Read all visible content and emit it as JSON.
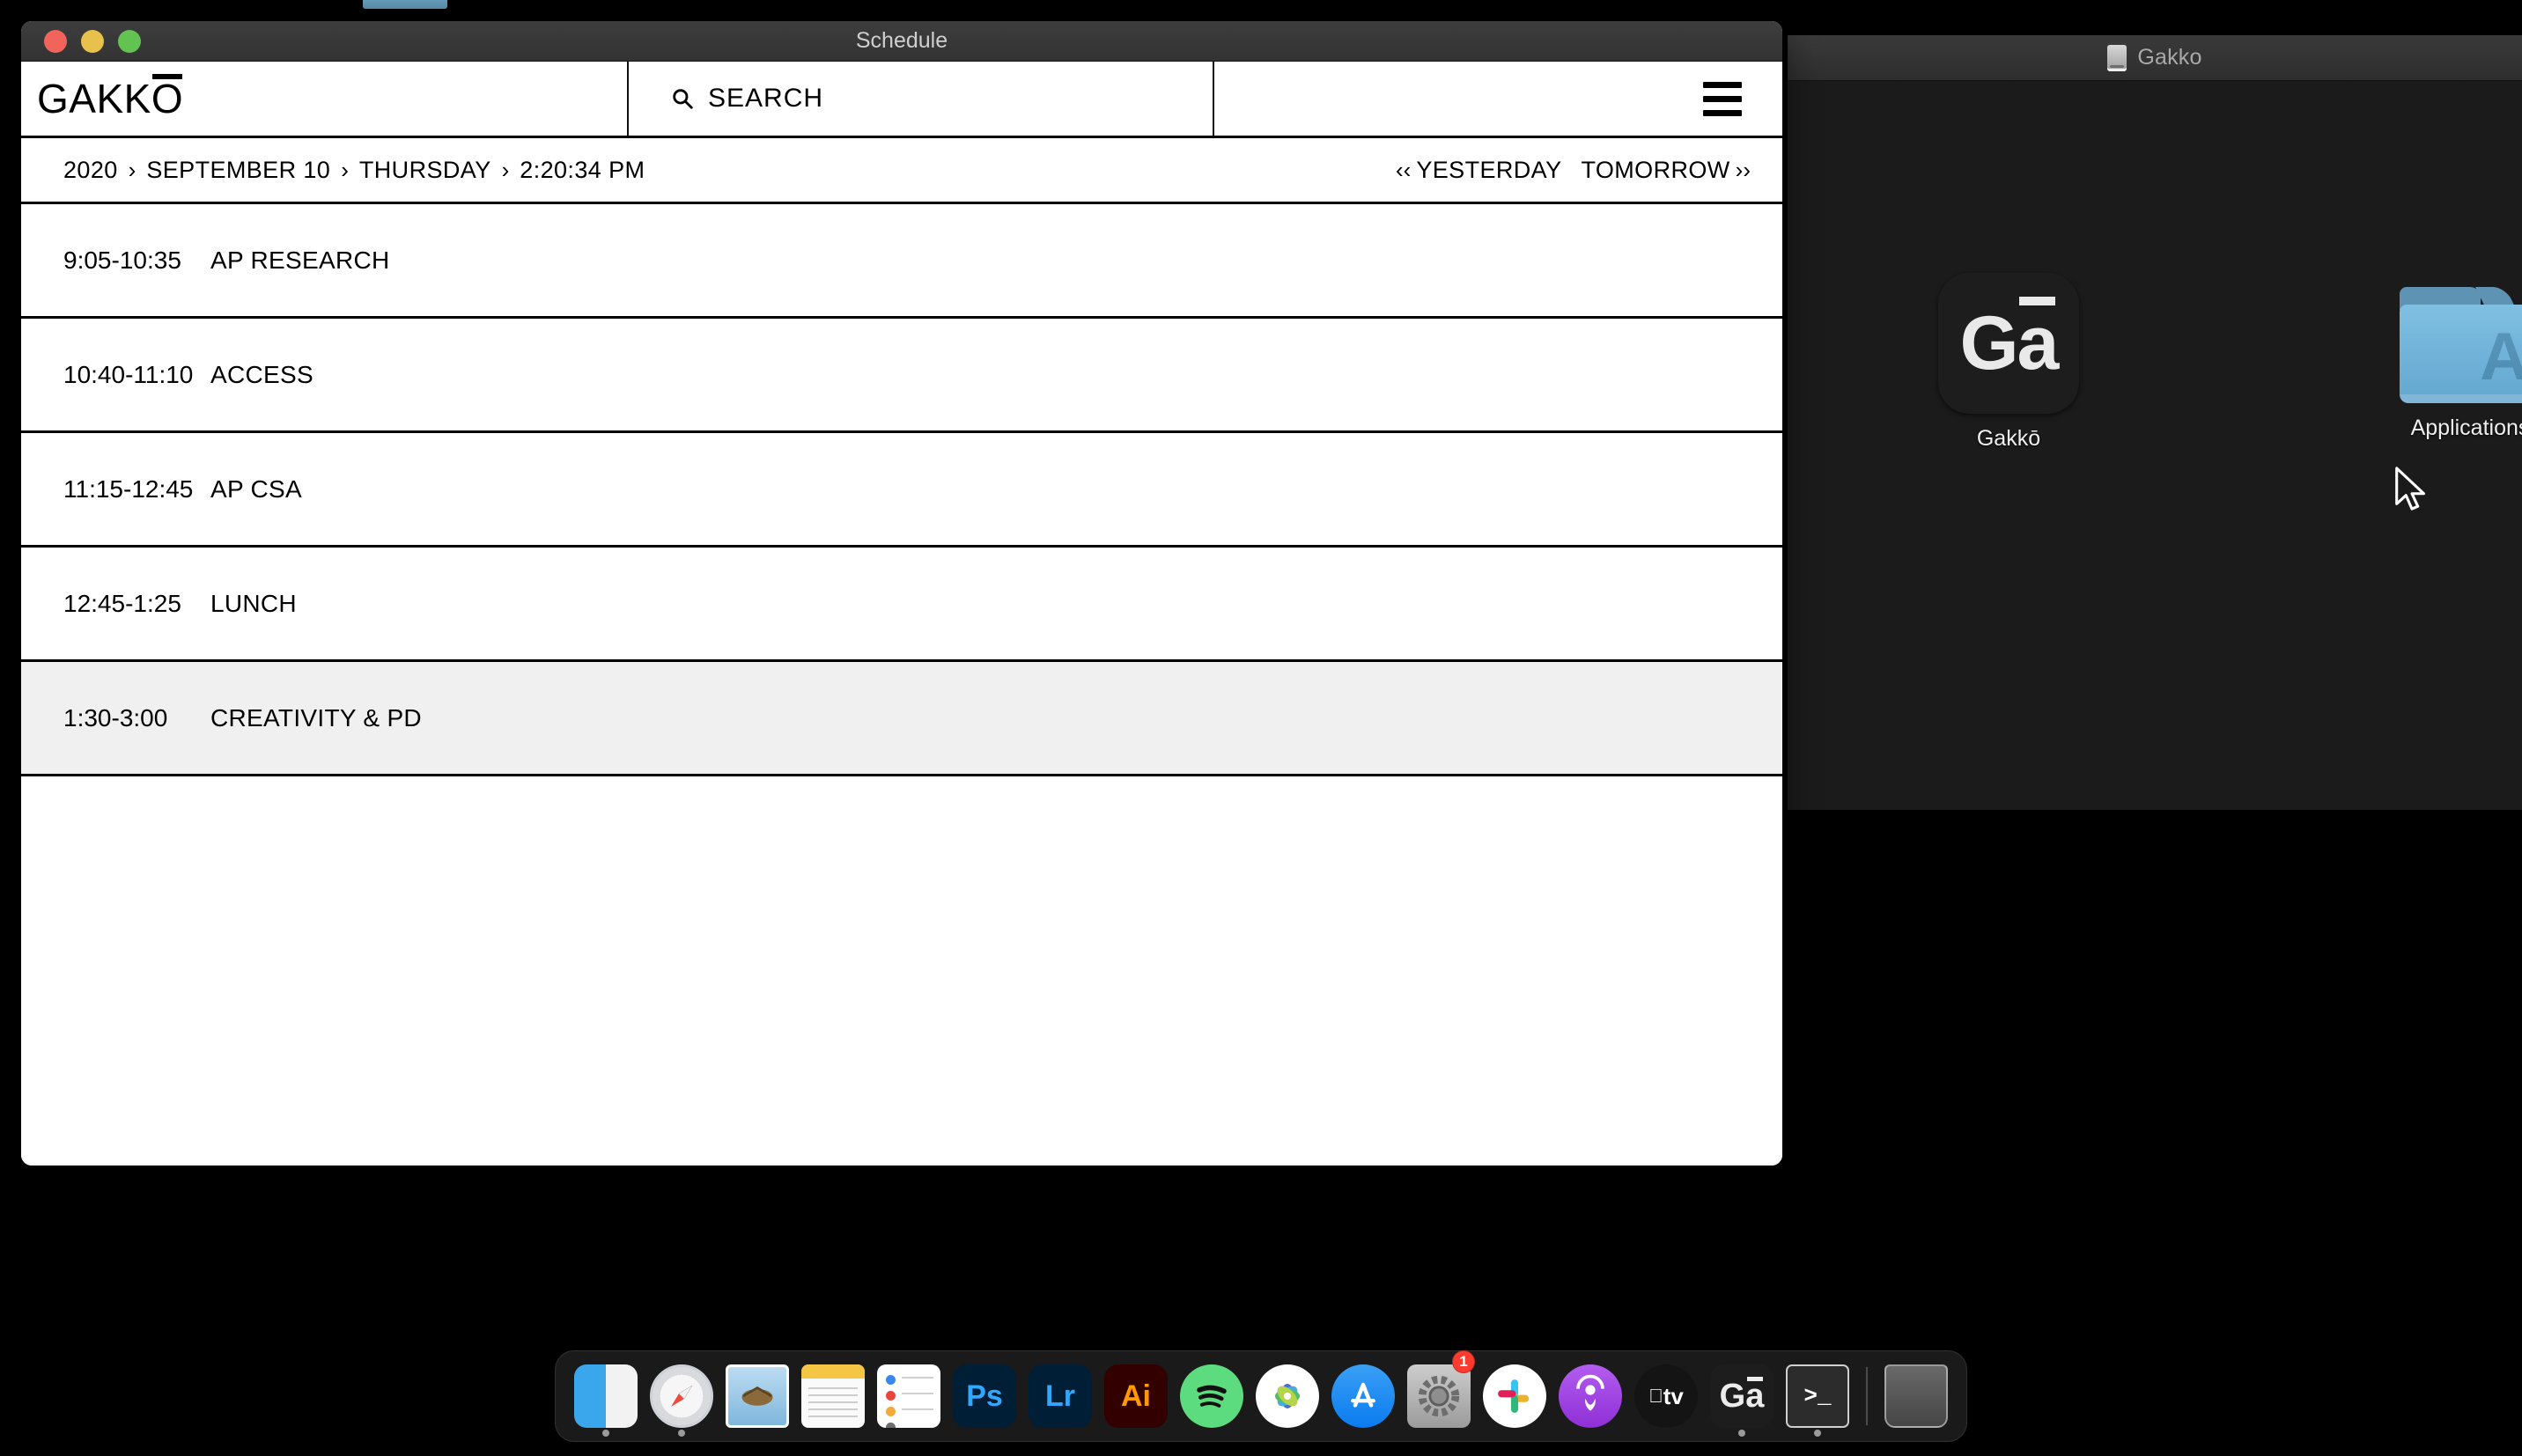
{
  "desktop": {
    "background_color": "#000000",
    "bg_window": {
      "title": "Gakko",
      "icon": "drive-icon"
    },
    "icons": [
      {
        "name": "Gakkō",
        "glyph": "Gā",
        "type": "app-tile"
      },
      {
        "name": "Applications",
        "glyph": "A",
        "type": "folder"
      }
    ]
  },
  "window": {
    "title": "Schedule",
    "traffic_lights": {
      "close": "#f1645b",
      "minimize": "#e8c14c",
      "maximize": "#62c252"
    },
    "header": {
      "logo": "GAKKŌ",
      "logo_prefix": "GAKK",
      "logo_macron_letter": "O",
      "search_placeholder": "SEARCH",
      "menu_icon": "hamburger-icon"
    },
    "breadcrumb": {
      "separator": "›",
      "items": [
        "2020",
        "SEPTEMBER 10",
        "THURSDAY",
        "2:20:34 PM"
      ],
      "year": "2020",
      "date": "SEPTEMBER 10",
      "weekday": "THURSDAY",
      "time": "2:20:34 PM"
    },
    "navigation": {
      "prev_chevrons": "‹‹",
      "prev_label": "YESTERDAY",
      "next_label": "TOMORROW",
      "next_chevrons": "››"
    },
    "schedule": {
      "highlight_color": "#f0f0f0",
      "rows": [
        {
          "time": "9:05-10:35",
          "course": "AP RESEARCH",
          "current": false
        },
        {
          "time": "10:40-11:10",
          "course": "ACCESS",
          "current": false
        },
        {
          "time": "11:15-12:45",
          "course": "AP CSA",
          "current": false
        },
        {
          "time": "12:45-1:25",
          "course": "LUNCH",
          "current": false
        },
        {
          "time": "1:30-3:00",
          "course": "CREATIVITY & PD",
          "current": true
        }
      ]
    }
  },
  "dock": {
    "items": [
      {
        "name": "Finder",
        "icon": "finder-icon",
        "running": true
      },
      {
        "name": "Safari",
        "icon": "safari-icon",
        "running": true
      },
      {
        "name": "Mail",
        "icon": "mail-icon",
        "running": false
      },
      {
        "name": "Notes",
        "icon": "notes-icon",
        "running": false
      },
      {
        "name": "Reminders",
        "icon": "reminders-icon",
        "running": false
      },
      {
        "name": "Adobe Photoshop",
        "icon": "photoshop-icon",
        "label": "Ps",
        "running": false
      },
      {
        "name": "Adobe Lightroom",
        "icon": "lightroom-icon",
        "label": "Lr",
        "running": false
      },
      {
        "name": "Adobe Illustrator",
        "icon": "illustrator-icon",
        "label": "Ai",
        "running": false
      },
      {
        "name": "Spotify",
        "icon": "spotify-icon",
        "running": false
      },
      {
        "name": "Photos",
        "icon": "photos-icon",
        "running": false
      },
      {
        "name": "App Store",
        "icon": "app-store-icon",
        "running": false
      },
      {
        "name": "System Preferences",
        "icon": "system-preferences-icon",
        "badge": "1",
        "running": false
      },
      {
        "name": "Slack",
        "icon": "slack-icon",
        "running": false
      },
      {
        "name": "Podcasts",
        "icon": "podcasts-icon",
        "running": false
      },
      {
        "name": "Apple TV",
        "icon": "apple-tv-icon",
        "label": "tv",
        "running": false
      },
      {
        "name": "Gakkō",
        "icon": "gakko-icon",
        "label": "Gā",
        "running": true
      },
      {
        "name": "Terminal",
        "icon": "terminal-icon",
        "label": ">_",
        "running": true
      },
      {
        "name": "Trash",
        "icon": "trash-icon",
        "running": false
      }
    ]
  }
}
